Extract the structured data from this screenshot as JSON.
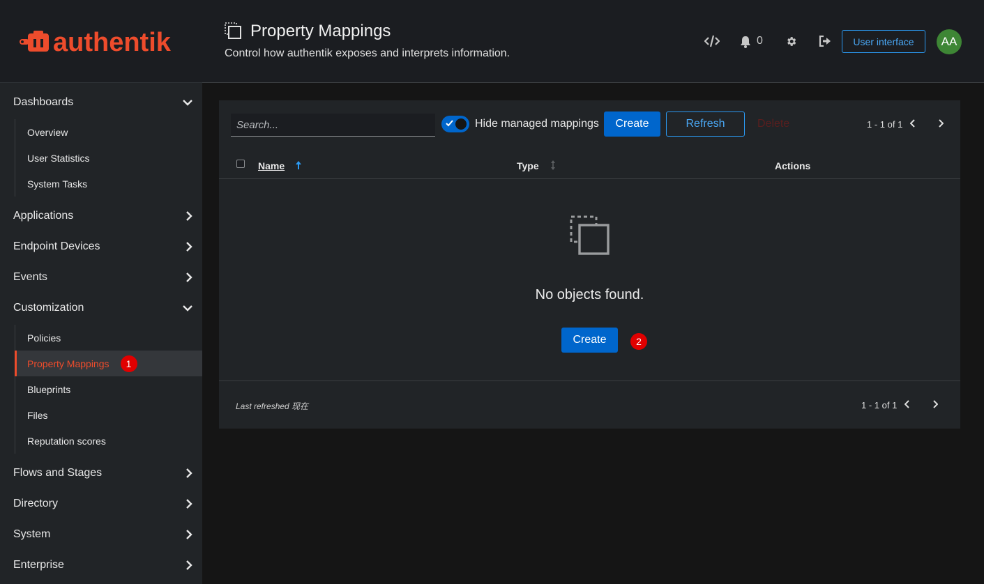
{
  "brand": {
    "name": "authentik",
    "color": "#ee4c2c"
  },
  "sidebar": {
    "groups": [
      {
        "label": "Dashboards",
        "expanded": true,
        "items": [
          "Overview",
          "User Statistics",
          "System Tasks"
        ]
      },
      {
        "label": "Applications",
        "expanded": false
      },
      {
        "label": "Endpoint Devices",
        "expanded": false
      },
      {
        "label": "Events",
        "expanded": false
      },
      {
        "label": "Customization",
        "expanded": true,
        "items": [
          "Policies",
          "Property Mappings",
          "Blueprints",
          "Files",
          "Reputation scores"
        ]
      },
      {
        "label": "Flows and Stages",
        "expanded": false
      },
      {
        "label": "Directory",
        "expanded": false
      },
      {
        "label": "System",
        "expanded": false
      },
      {
        "label": "Enterprise",
        "expanded": false
      }
    ],
    "active_item": "Property Mappings",
    "active_badge": "1"
  },
  "header": {
    "title": "Property Mappings",
    "description": "Control how authentik exposes and interprets information.",
    "notification_count": "0",
    "user_interface_label": "User interface",
    "avatar_initials": "AA"
  },
  "toolbar": {
    "search_placeholder": "Search...",
    "toggle_label": "Hide managed mappings",
    "toggle_on": true,
    "create_label": "Create",
    "refresh_label": "Refresh",
    "delete_label": "Delete",
    "pagination": "1 - 1 of 1"
  },
  "table": {
    "columns": [
      "Name",
      "Type",
      "Actions"
    ],
    "empty_text": "No objects found.",
    "empty_create_label": "Create",
    "empty_badge": "2"
  },
  "footer": {
    "last_refreshed": "Last refreshed 现在",
    "pagination": "1 - 1 of 1"
  },
  "colors": {
    "accent": "#0066cc",
    "link": "#2b9af3",
    "badge": "#e00000",
    "active": "#ee4c2c"
  }
}
